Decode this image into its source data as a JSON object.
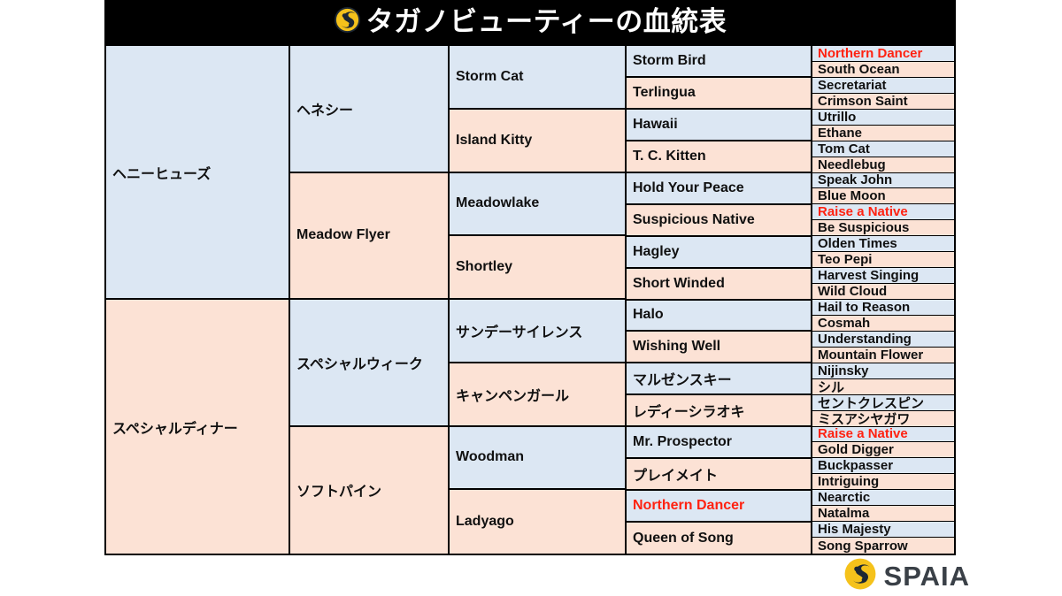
{
  "header": {
    "title": "タガノビューティーの血統表",
    "logo_icon": "spaia-swirl-logo-icon",
    "background_color": "#000000",
    "text_color": "#ffffff"
  },
  "footer": {
    "brand": "SPAIA",
    "logo_icon": "spaia-swirl-logo-icon",
    "brand_color": "#3a4047",
    "mark_color": "#f5c21b"
  },
  "colors": {
    "sire_blue": "#dce7f3",
    "dam_pink": "#fce2d5",
    "highlight_red": "#ff2211",
    "border": "#000000"
  },
  "pedigree": {
    "generation_1": [
      {
        "name": "ヘニーヒューズ",
        "color": "blue",
        "highlight": false
      },
      {
        "name": "スペシャルディナー",
        "color": "pink",
        "highlight": false
      }
    ],
    "generation_2": [
      {
        "name": "ヘネシー",
        "color": "blue",
        "highlight": false
      },
      {
        "name": "Meadow Flyer",
        "color": "pink",
        "highlight": false
      },
      {
        "name": "スペシャルウィーク",
        "color": "blue",
        "highlight": false
      },
      {
        "name": "ソフトパイン",
        "color": "pink",
        "highlight": false
      }
    ],
    "generation_3": [
      {
        "name": "Storm Cat",
        "color": "blue",
        "highlight": false
      },
      {
        "name": "Island Kitty",
        "color": "pink",
        "highlight": false
      },
      {
        "name": "Meadowlake",
        "color": "blue",
        "highlight": false
      },
      {
        "name": "Shortley",
        "color": "pink",
        "highlight": false
      },
      {
        "name": "サンデーサイレンス",
        "color": "blue",
        "highlight": false
      },
      {
        "name": "キャンペンガール",
        "color": "pink",
        "highlight": false
      },
      {
        "name": "Woodman",
        "color": "blue",
        "highlight": false
      },
      {
        "name": "Ladyago",
        "color": "pink",
        "highlight": false
      }
    ],
    "generation_4": [
      {
        "name": "Storm Bird",
        "color": "blue",
        "highlight": false
      },
      {
        "name": "Terlingua",
        "color": "pink",
        "highlight": false
      },
      {
        "name": "Hawaii",
        "color": "blue",
        "highlight": false
      },
      {
        "name": "T. C. Kitten",
        "color": "pink",
        "highlight": false
      },
      {
        "name": "Hold Your Peace",
        "color": "blue",
        "highlight": false
      },
      {
        "name": "Suspicious Native",
        "color": "pink",
        "highlight": false
      },
      {
        "name": "Hagley",
        "color": "blue",
        "highlight": false
      },
      {
        "name": "Short Winded",
        "color": "pink",
        "highlight": false
      },
      {
        "name": "Halo",
        "color": "blue",
        "highlight": false
      },
      {
        "name": "Wishing Well",
        "color": "pink",
        "highlight": false
      },
      {
        "name": "マルゼンスキー",
        "color": "blue",
        "highlight": false
      },
      {
        "name": "レディーシラオキ",
        "color": "pink",
        "highlight": false
      },
      {
        "name": "Mr. Prospector",
        "color": "blue",
        "highlight": false
      },
      {
        "name": "プレイメイト",
        "color": "pink",
        "highlight": false
      },
      {
        "name": "Northern Dancer",
        "color": "blue",
        "highlight": true
      },
      {
        "name": "Queen of Song",
        "color": "pink",
        "highlight": false
      }
    ],
    "generation_5": [
      {
        "name": "Northern Dancer",
        "color": "blue",
        "highlight": true
      },
      {
        "name": "South Ocean",
        "color": "pink",
        "highlight": false
      },
      {
        "name": "Secretariat",
        "color": "blue",
        "highlight": false
      },
      {
        "name": "Crimson Saint",
        "color": "pink",
        "highlight": false
      },
      {
        "name": "Utrillo",
        "color": "blue",
        "highlight": false
      },
      {
        "name": "Ethane",
        "color": "pink",
        "highlight": false
      },
      {
        "name": "Tom Cat",
        "color": "blue",
        "highlight": false
      },
      {
        "name": "Needlebug",
        "color": "pink",
        "highlight": false
      },
      {
        "name": "Speak John",
        "color": "blue",
        "highlight": false
      },
      {
        "name": "Blue Moon",
        "color": "pink",
        "highlight": false
      },
      {
        "name": "Raise a Native",
        "color": "blue",
        "highlight": true
      },
      {
        "name": "Be Suspicious",
        "color": "pink",
        "highlight": false
      },
      {
        "name": "Olden Times",
        "color": "blue",
        "highlight": false
      },
      {
        "name": "Teo Pepi",
        "color": "pink",
        "highlight": false
      },
      {
        "name": "Harvest Singing",
        "color": "blue",
        "highlight": false
      },
      {
        "name": "Wild Cloud",
        "color": "pink",
        "highlight": false
      },
      {
        "name": "Hail to Reason",
        "color": "blue",
        "highlight": false
      },
      {
        "name": "Cosmah",
        "color": "pink",
        "highlight": false
      },
      {
        "name": "Understanding",
        "color": "blue",
        "highlight": false
      },
      {
        "name": "Mountain Flower",
        "color": "pink",
        "highlight": false
      },
      {
        "name": "Nijinsky",
        "color": "blue",
        "highlight": false
      },
      {
        "name": "シル",
        "color": "pink",
        "highlight": false
      },
      {
        "name": "セントクレスピン",
        "color": "blue",
        "highlight": false
      },
      {
        "name": "ミスアシヤガワ",
        "color": "pink",
        "highlight": false
      },
      {
        "name": "Raise a Native",
        "color": "blue",
        "highlight": true
      },
      {
        "name": "Gold Digger",
        "color": "pink",
        "highlight": false
      },
      {
        "name": "Buckpasser",
        "color": "blue",
        "highlight": false
      },
      {
        "name": "Intriguing",
        "color": "pink",
        "highlight": false
      },
      {
        "name": "Nearctic",
        "color": "blue",
        "highlight": false
      },
      {
        "name": "Natalma",
        "color": "pink",
        "highlight": false
      },
      {
        "name": "His Majesty",
        "color": "blue",
        "highlight": false
      },
      {
        "name": "Song Sparrow",
        "color": "pink",
        "highlight": false
      }
    ]
  }
}
